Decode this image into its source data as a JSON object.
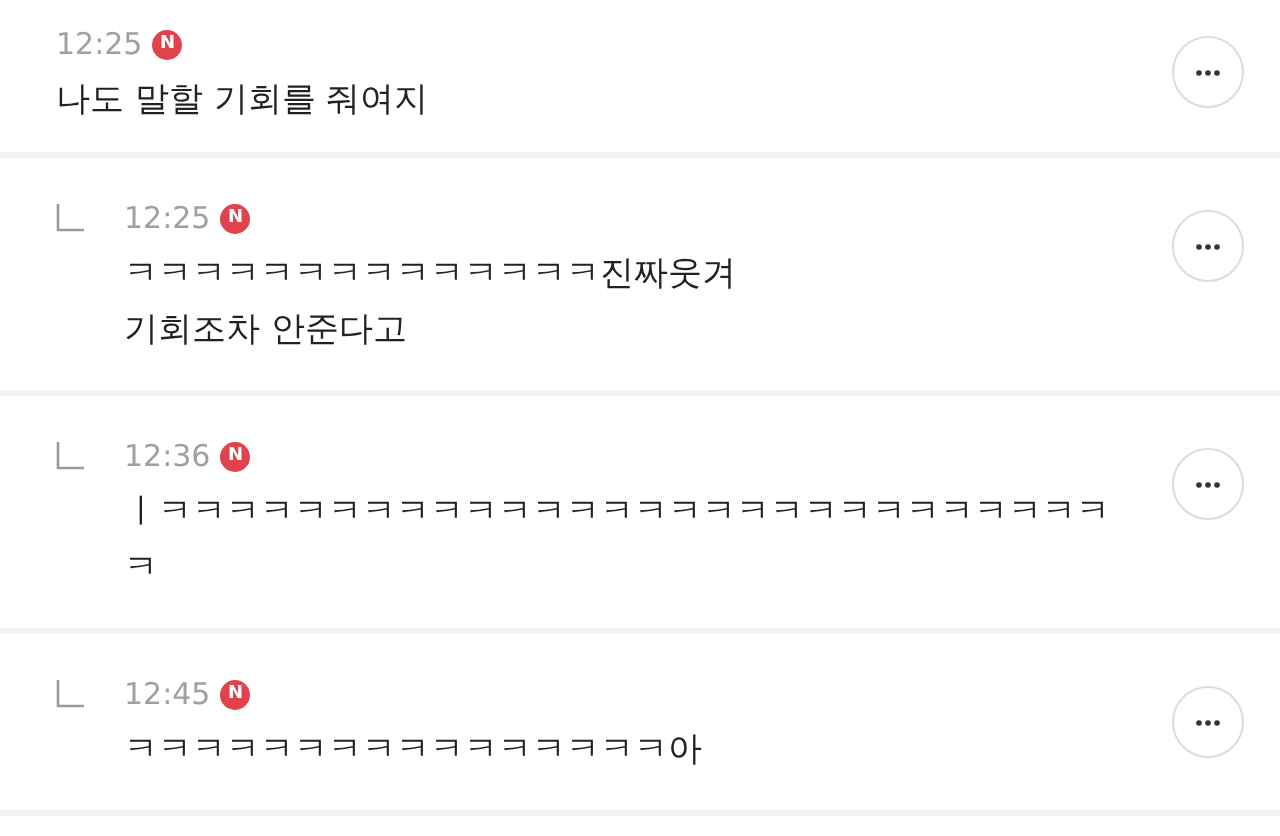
{
  "comments": [
    {
      "kind": "comment",
      "time": "12:25",
      "badge": "N",
      "lines": [
        "나도 말할 기회를 줘여지"
      ]
    },
    {
      "kind": "reply",
      "time": "12:25",
      "badge": "N",
      "lines": [
        "ㅋㅋㅋㅋㅋㅋㅋㅋㅋㅋㅋㅋㅋㅋ진짜웃겨",
        "기회조차 안준다고"
      ]
    },
    {
      "kind": "reply",
      "time": "12:36",
      "badge": "N",
      "lines": [
        "ㅣㅋㅋㅋㅋㅋㅋㅋㅋㅋㅋㅋㅋㅋㅋㅋㅋㅋㅋㅋㅋㅋㅋㅋㅋㅋㅋㅋㅋ",
        "ㅋ"
      ]
    },
    {
      "kind": "reply",
      "time": "12:45",
      "badge": "N",
      "lines": [
        "ㅋㅋㅋㅋㅋㅋㅋㅋㅋㅋㅋㅋㅋㅋㅋㅋ아"
      ]
    }
  ]
}
